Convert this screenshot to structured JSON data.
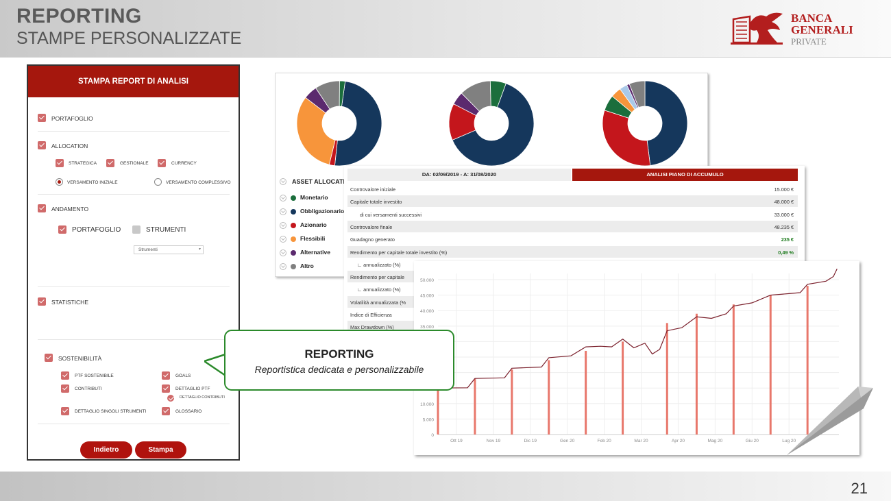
{
  "header": {
    "title": "REPORTING",
    "subtitle": "STAMPE PERSONALIZZATE"
  },
  "logo": {
    "line1": "BANCA",
    "line2": "GENERALI",
    "line3": "PRIVATE"
  },
  "page_number": "21",
  "form": {
    "title": "STAMPA REPORT DI ANALISI",
    "portafoglio": "PORTAFOGLIO",
    "allocation": "ALLOCATION",
    "strategica": "STRATEGICA",
    "gestionale": "GESTIONALE",
    "currency": "CURRENCY",
    "versamento_iniziale": "VERSAMENTO INIZIALE",
    "versamento_complessivo": "VERSAMENTO COMPLESSIVO",
    "andamento": "ANDAMENTO",
    "andamento_portafoglio": "PORTAFOGLIO",
    "strumenti": "STRUMENTI",
    "select_value": "Strumenti",
    "statistiche": "STATISTICHE",
    "sostenibilita": "SOSTENIBILITÀ",
    "ptf_sostenibile": "PTF SOSTENIBILE",
    "goals": "GOALS",
    "contributi": "CONTRIBUTI",
    "dettaglio_ptf": "DETTAGLIO PTF",
    "dettaglio_contributi": "DETTAGLIO CONTRIBUTI",
    "dettaglio_singoli": "DETTAGLIO SINGOLI STRUMENTI",
    "glossario": "GLOSSARIO",
    "btn_back": "Indietro",
    "btn_print": "Stampa"
  },
  "allocation_panel": {
    "legend_title": "ASSET ALLOCATI",
    "legend": [
      {
        "label": "Monetario",
        "color": "#1b6e3c"
      },
      {
        "label": "Obbligazionario",
        "color": "#15375c"
      },
      {
        "label": "Azionario",
        "color": "#c4161c"
      },
      {
        "label": "Flessibili",
        "color": "#f7953b"
      },
      {
        "label": "Alternative",
        "color": "#5b2a6e"
      },
      {
        "label": "Altro",
        "color": "#808080"
      }
    ],
    "donuts": [
      [
        {
          "v": 47,
          "c": "#15375c"
        },
        {
          "v": 2,
          "c": "#c4161c"
        },
        {
          "v": 30,
          "c": "#f7953b"
        },
        {
          "v": 5,
          "c": "#5b2a6e"
        },
        {
          "v": 9,
          "c": "#808080"
        },
        {
          "v": 2,
          "c": "#1b6e3c"
        }
      ],
      [
        {
          "v": 63,
          "c": "#15375c"
        },
        {
          "v": 14,
          "c": "#c4161c"
        },
        {
          "v": 5,
          "c": "#5b2a6e"
        },
        {
          "v": 12,
          "c": "#808080"
        },
        {
          "v": 6,
          "c": "#1b6e3c"
        }
      ],
      [
        {
          "v": 48,
          "c": "#15375c"
        },
        {
          "v": 32,
          "c": "#c4161c"
        },
        {
          "v": 6,
          "c": "#1b6e3c"
        },
        {
          "v": 4,
          "c": "#f7953b"
        },
        {
          "v": 3,
          "c": "#a9c9e8"
        },
        {
          "v": 1,
          "c": "#5b2a6e"
        },
        {
          "v": 6,
          "c": "#808080"
        }
      ]
    ]
  },
  "table": {
    "period": "DA: 02/09/2019 - A: 31/08/2020",
    "heading": "ANALISI PIANO DI ACCUMULO",
    "rows": [
      {
        "k": "Controvalore iniziale",
        "v": "15.000 €"
      },
      {
        "k": "Capitale totale investito",
        "v": "48.000 €"
      },
      {
        "k": "di cui versamenti successivi",
        "v": "33.000 €"
      },
      {
        "k": "Controvalore finale",
        "v": "48.235 €"
      },
      {
        "k": "Guadagno generato",
        "v": "235 €"
      },
      {
        "k": "Rendimento per capitale totale investito (%)",
        "v": "0,49 %"
      },
      {
        "k": "∟ annualizzato (%)",
        "v": ""
      },
      {
        "k": "Rendimento per capitale",
        "v": ""
      },
      {
        "k": "∟ annualizzato (%)",
        "v": ""
      },
      {
        "k": "Volatilità annualizzata (%",
        "v": ""
      },
      {
        "k": "Indice di Efficienza",
        "v": ""
      },
      {
        "k": "Max Drawdown (%)",
        "v": ""
      }
    ]
  },
  "chart_data": {
    "type": "line",
    "title": "",
    "xlabel": "",
    "ylabel": "",
    "ylim": [
      0,
      52000
    ],
    "yticks": [
      "0",
      "5.000",
      "10.000",
      "15.000",
      "20.000",
      "25.000",
      "30.000",
      "35.000",
      "40.000",
      "45.000",
      "50.000"
    ],
    "x_labels": [
      "Ott 19",
      "Nov 19",
      "Dic 19",
      "Gen 20",
      "Feb 20",
      "Mar 20",
      "Apr 20",
      "Mag 20",
      "Giu 20",
      "Lug 20"
    ],
    "contributions": [
      {
        "t": 0.0,
        "v": 15000
      },
      {
        "t": 1.0,
        "v": 18000
      },
      {
        "t": 2.0,
        "v": 21000
      },
      {
        "t": 3.0,
        "v": 24000
      },
      {
        "t": 4.0,
        "v": 27000
      },
      {
        "t": 5.0,
        "v": 30000
      },
      {
        "t": 6.2,
        "v": 36000
      },
      {
        "t": 7.0,
        "v": 39000
      },
      {
        "t": 8.0,
        "v": 42000
      },
      {
        "t": 9.0,
        "v": 45000
      },
      {
        "t": 10.0,
        "v": 48000
      }
    ],
    "series": [
      {
        "color": "#7a1f2b",
        "points": [
          [
            0.0,
            15000
          ],
          [
            0.8,
            15100
          ],
          [
            1.0,
            18100
          ],
          [
            1.8,
            18300
          ],
          [
            2.0,
            21400
          ],
          [
            2.8,
            21800
          ],
          [
            3.0,
            24800
          ],
          [
            3.6,
            25400
          ],
          [
            4.0,
            28300
          ],
          [
            4.4,
            28500
          ],
          [
            4.7,
            28300
          ],
          [
            5.0,
            30800
          ],
          [
            5.3,
            28000
          ],
          [
            5.6,
            29500
          ],
          [
            5.8,
            26000
          ],
          [
            6.0,
            27500
          ],
          [
            6.2,
            33500
          ],
          [
            6.6,
            34500
          ],
          [
            7.0,
            38000
          ],
          [
            7.4,
            37500
          ],
          [
            7.8,
            39000
          ],
          [
            8.0,
            41500
          ],
          [
            8.5,
            42500
          ],
          [
            9.0,
            45000
          ],
          [
            9.5,
            45500
          ],
          [
            9.8,
            45800
          ],
          [
            10.0,
            48500
          ],
          [
            10.5,
            49500
          ],
          [
            10.7,
            51000
          ],
          [
            10.8,
            53500
          ]
        ]
      }
    ]
  },
  "callout": {
    "title": "REPORTING",
    "text": "Reportistica dedicata e personalizzabile"
  }
}
